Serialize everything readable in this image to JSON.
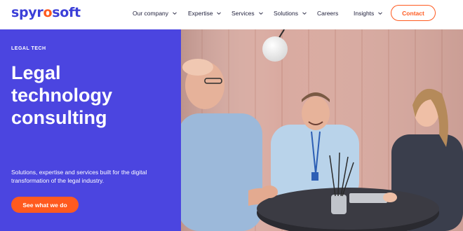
{
  "header": {
    "logo_text_before": "spyr",
    "logo_text_mark": "o",
    "logo_text_after": "soft",
    "nav": [
      {
        "label": "Our company",
        "has_dropdown": true
      },
      {
        "label": "Expertise",
        "has_dropdown": true
      },
      {
        "label": "Services",
        "has_dropdown": true
      },
      {
        "label": "Solutions",
        "has_dropdown": true
      },
      {
        "label": "Careers",
        "has_dropdown": false
      },
      {
        "label": "Insights",
        "has_dropdown": true
      }
    ],
    "contact_label": "Contact"
  },
  "hero": {
    "eyebrow": "LEGAL TECH",
    "headline_lines": [
      "Legal",
      "technology",
      "consulting"
    ],
    "description": "Solutions, expertise and services built for the digital transformation of the legal industry.",
    "cta_label": "See what we do"
  },
  "colors": {
    "brand_blue": "#4b45e0",
    "accent_orange": "#ff5a1f",
    "nav_text": "#1e1e3a"
  },
  "icons": [
    "chevron-down-icon"
  ]
}
